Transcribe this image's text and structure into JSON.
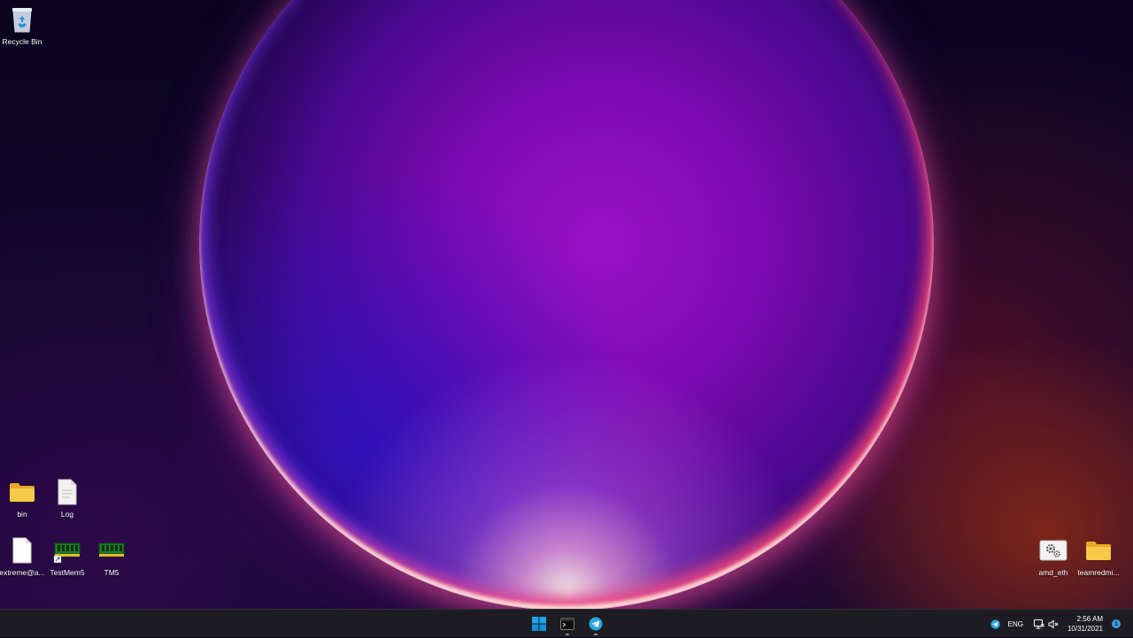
{
  "desktop": {
    "icons": [
      {
        "label": "Recycle Bin",
        "icon": "recycle-bin-icon"
      },
      {
        "label": "bin",
        "icon": "folder-icon"
      },
      {
        "label": "Log",
        "icon": "text-file-icon"
      },
      {
        "label": "extreme@a...",
        "icon": "blank-file-icon"
      },
      {
        "label": "TestMem5",
        "icon": "ram-module-shortcut-icon"
      },
      {
        "label": "TM5",
        "icon": "ram-module-icon"
      },
      {
        "label": "amd_eth",
        "icon": "config-settings-icon"
      },
      {
        "label": "teamredmi...",
        "icon": "folder-icon"
      }
    ]
  },
  "taskbar": {
    "pinned": [
      {
        "name": "Start",
        "icon": "windows-logo-icon"
      },
      {
        "name": "Terminal",
        "icon": "terminal-icon",
        "running": true
      },
      {
        "name": "Telegram",
        "icon": "telegram-icon",
        "running": true
      }
    ],
    "tray": {
      "language": "ENG",
      "time": "2:56 AM",
      "date": "10/31/2021",
      "notification_count": "1"
    }
  },
  "colors": {
    "taskbar_bg": "#1c1c22",
    "folder_yellow": "#f5c342",
    "telegram_blue": "#2ca5e0",
    "windows_blue": "#0fa3f0"
  }
}
